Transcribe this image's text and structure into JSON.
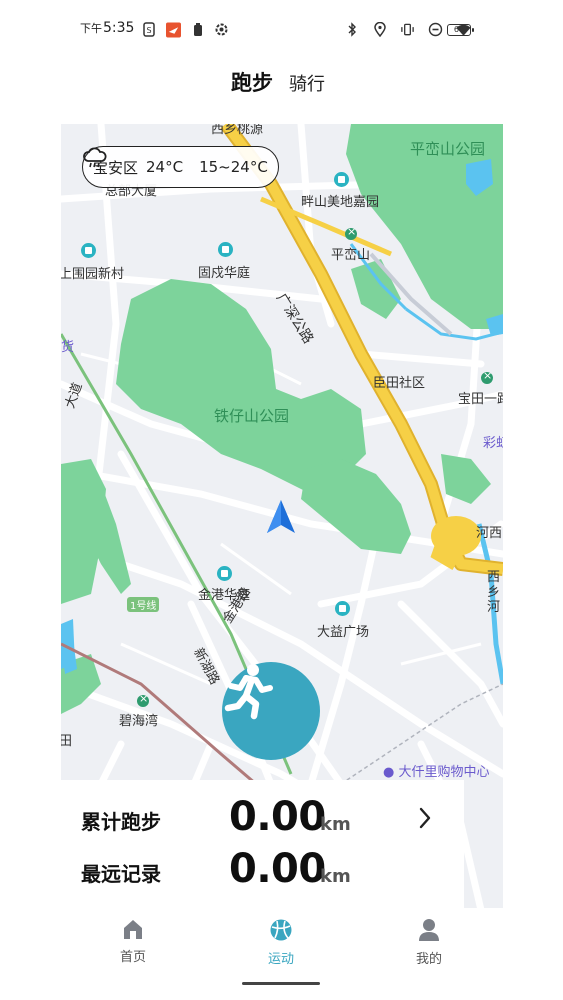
{
  "status_bar": {
    "period": "下午",
    "time": "5:35",
    "battery": "60",
    "icons": [
      "sim-icon",
      "app-notification-icon",
      "battery-saver-icon",
      "settings-icon",
      "bluetooth-icon",
      "location-icon",
      "vibrate-icon",
      "do-not-disturb-icon",
      "wifi-icon",
      "battery-icon"
    ]
  },
  "header": {
    "tabs": [
      {
        "label": "跑步",
        "active": true
      },
      {
        "label": "骑行",
        "active": false
      }
    ]
  },
  "map": {
    "weather": {
      "district": "宝安区",
      "current_temp": "24°C",
      "range": "15~24°C",
      "icon": "rain-cloud-icon"
    },
    "labels": {
      "pingluan_park": "平峦山公园",
      "panshan": "畔山美地嘉园",
      "zongbu": "总部大厦",
      "pingluanshan": "平峦山",
      "shangwei": "上围园新村",
      "guchenghuating": "固戍华庭",
      "guangshen": "广深公路",
      "huo": "货",
      "chentian": "臣田社区",
      "baotian": "宝田一路",
      "tiezai_park": "铁仔山公园",
      "caihong": "彩虹",
      "dao": "大道",
      "hexi": "河西",
      "xixiang": "西乡河",
      "jingang": "金港华庭",
      "dayi": "大益广场",
      "jingang_road": "金港路",
      "xinhu_road": "新湖路",
      "line1": "1号线",
      "bihaiwan": "碧海湾",
      "daqianli": "大仟里购物中心",
      "top_cut": "西乡桃源",
      "tian": "田"
    },
    "colors": {
      "park": "#7dd39b",
      "highway": "#f6d046",
      "highway_edge": "#e0b22e",
      "water": "#5bc3f0",
      "road": "#ffffff",
      "base": "#eef0f4"
    }
  },
  "start_button": {
    "icon": "running-person-icon",
    "color": "#3aa6c0"
  },
  "stats": {
    "total": {
      "label": "累计跑步",
      "value": "0.00",
      "unit": "km"
    },
    "longest": {
      "label": "最远记录",
      "value": "0.00",
      "unit": "km"
    }
  },
  "bottom_nav": {
    "items": [
      {
        "label": "首页",
        "icon": "home-icon",
        "active": false
      },
      {
        "label": "运动",
        "icon": "sport-ball-icon",
        "active": true
      },
      {
        "label": "我的",
        "icon": "profile-icon",
        "active": false
      }
    ],
    "active_color": "#3aa6c0"
  }
}
